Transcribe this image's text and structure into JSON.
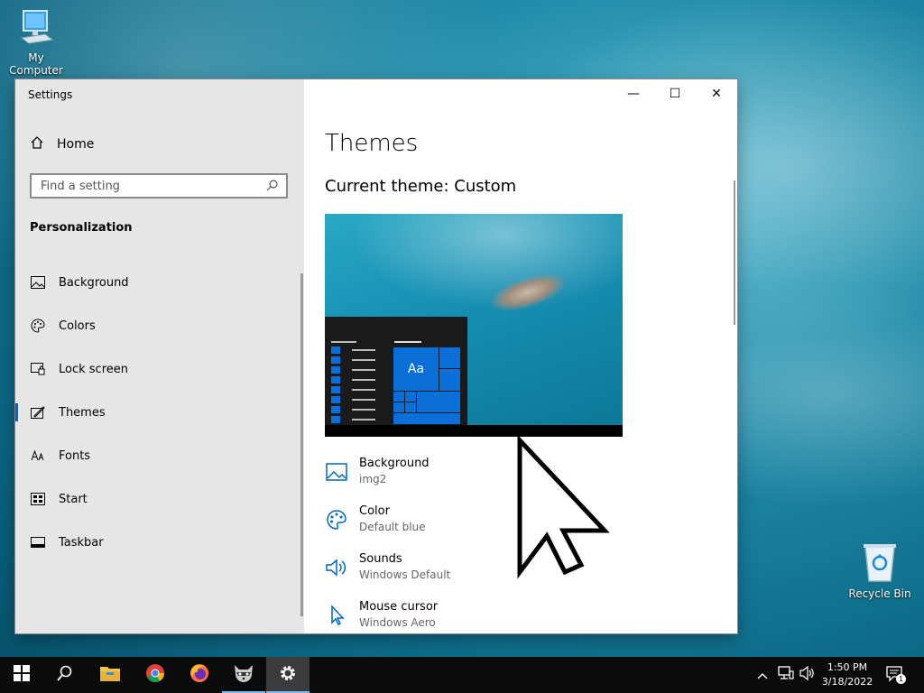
{
  "desktop": {
    "icons": [
      {
        "label": "My Computer"
      },
      {
        "label": "Recycle Bin"
      }
    ]
  },
  "window": {
    "title": "Settings",
    "controls": {
      "minimize": "—",
      "maximize": "☐",
      "close": "✕"
    }
  },
  "sidebar": {
    "home_label": "Home",
    "search_placeholder": "Find a setting",
    "section_title": "Personalization",
    "items": [
      {
        "label": "Background",
        "icon": "picture-icon"
      },
      {
        "label": "Colors",
        "icon": "palette-icon"
      },
      {
        "label": "Lock screen",
        "icon": "lock-screen-icon"
      },
      {
        "label": "Themes",
        "icon": "themes-icon",
        "active": true
      },
      {
        "label": "Fonts",
        "icon": "fonts-icon"
      },
      {
        "label": "Start",
        "icon": "start-icon"
      },
      {
        "label": "Taskbar",
        "icon": "taskbar-icon"
      }
    ]
  },
  "main": {
    "title": "Themes",
    "current_theme": "Current theme: Custom",
    "preview_tile_text": "Aa",
    "properties": [
      {
        "name": "Background",
        "value": "img2",
        "icon": "picture-icon"
      },
      {
        "name": "Color",
        "value": "Default blue",
        "icon": "palette-icon"
      },
      {
        "name": "Sounds",
        "value": "Windows Default",
        "icon": "speaker-icon"
      },
      {
        "name": "Mouse cursor",
        "value": "Windows Aero",
        "icon": "mouse-pointer-icon"
      }
    ]
  },
  "taskbar": {
    "clock_time": "1:50 PM",
    "clock_date": "3/18/2022",
    "notification_count": "1",
    "accent": "#0078d7"
  }
}
